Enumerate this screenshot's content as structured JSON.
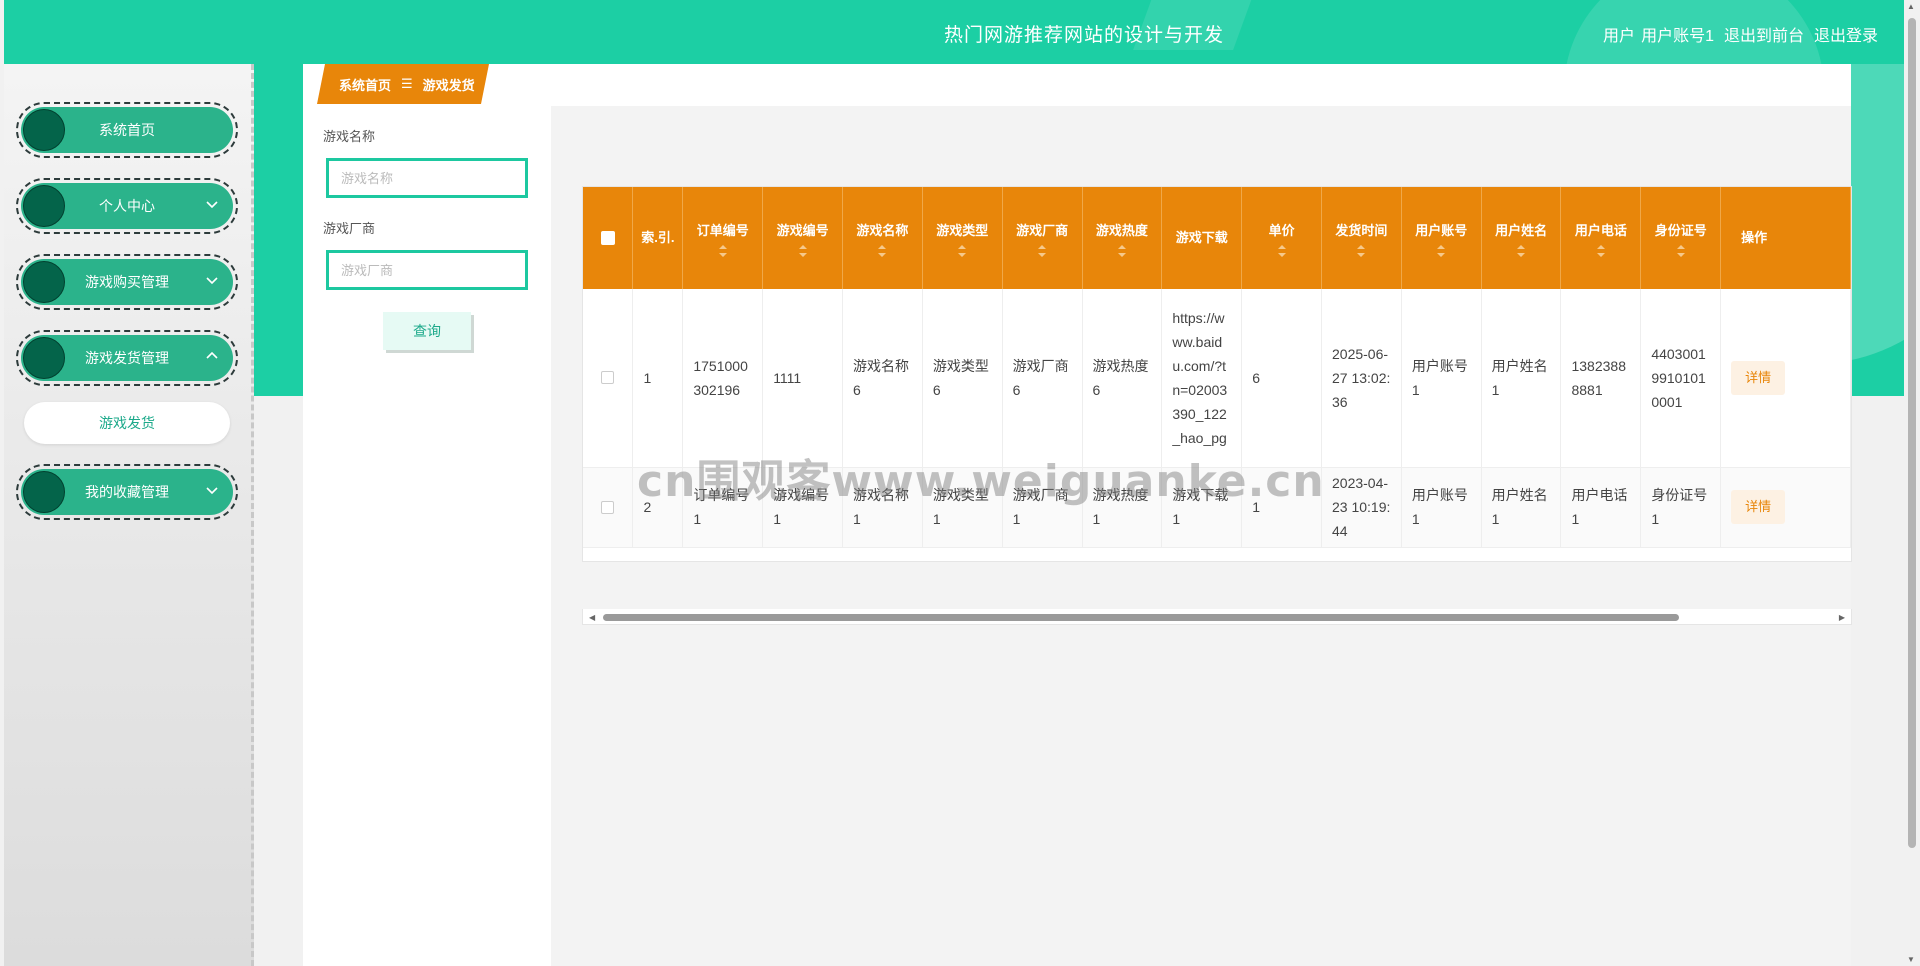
{
  "header": {
    "title": "热门网游推荐网站的设计与开发",
    "user_role": "用户",
    "username": "用户账号1",
    "back_to_front": "退出到前台",
    "logout": "退出登录"
  },
  "sidebar": {
    "items": [
      {
        "label": "系统首页"
      },
      {
        "label": "个人中心"
      },
      {
        "label": "游戏购买管理"
      },
      {
        "label": "游戏发货管理"
      },
      {
        "label": "我的收藏管理"
      }
    ],
    "submenu_active": "游戏发货"
  },
  "breadcrumb": {
    "home": "系统首页",
    "sep": "☰",
    "current": "游戏发货"
  },
  "filter": {
    "name_label": "游戏名称",
    "name_placeholder": "游戏名称",
    "vendor_label": "游戏厂商",
    "vendor_placeholder": "游戏厂商",
    "query_button": "查询"
  },
  "table": {
    "headers": [
      "索引",
      "订单编号",
      "游戏编号",
      "游戏名称",
      "游戏类型",
      "游戏厂商",
      "游戏热度",
      "游戏下载",
      "单价",
      "发货时间",
      "用户账号",
      "用户姓名",
      "用户电话",
      "身份证号",
      "操作"
    ],
    "header_display": [
      "索.引.",
      "订单编号",
      "游戏编号",
      "游戏名称",
      "游戏类型",
      "游戏厂商",
      "游戏热度",
      "游戏下载",
      "单价",
      "发货时间",
      "用户账号",
      "用户姓名",
      "用户电话",
      "身份证号",
      "操作"
    ],
    "rows": [
      [
        "1",
        "1751000302196",
        "1111",
        "游戏名称6",
        "游戏类型6",
        "游戏厂商6",
        "游戏热度6",
        "https://www.baidu.com/?tn=02003390_122_hao_pg",
        "6",
        "2025-06-27 13:02:36",
        "用户账号1",
        "用户姓名1",
        "13823888881",
        "440300199101010001"
      ],
      [
        "2",
        "订单编号1",
        "游戏编号1",
        "游戏名称1",
        "游戏类型1",
        "游戏厂商1",
        "游戏热度1",
        "游戏下载1",
        "1",
        "2023-04-23 10:19:44",
        "用户账号1",
        "用户姓名1",
        "用户电话1",
        "身份证号1"
      ]
    ],
    "detail_label": "详情"
  },
  "watermark": "cn围观客www.weiguanke.cn",
  "colors": {
    "header_green": "#1ccfa4",
    "accent_orange": "#e8860a",
    "menu_green": "#2bb38b"
  }
}
